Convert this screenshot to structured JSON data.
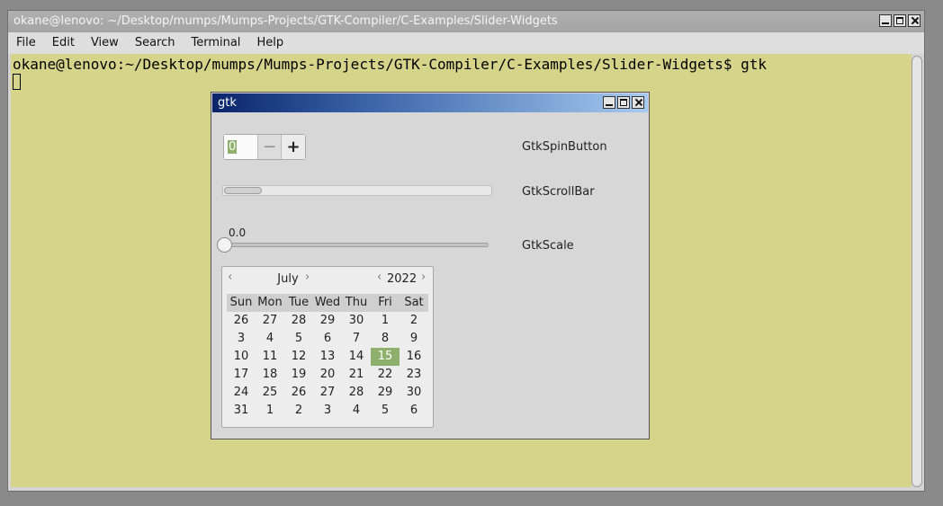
{
  "terminal": {
    "title": "okane@lenovo: ~/Desktop/mumps/Mumps-Projects/GTK-Compiler/C-Examples/Slider-Widgets",
    "menu": [
      "File",
      "Edit",
      "View",
      "Search",
      "Terminal",
      "Help"
    ],
    "prompt": "okane@lenovo:~/Desktop/mumps/Mumps-Projects/GTK-Compiler/C-Examples/Slider-Widgets$ gtk",
    "background_color": "#d6d38a"
  },
  "dialog": {
    "title": "gtk",
    "spin": {
      "value": "0",
      "minus": "−",
      "plus": "+",
      "label": "GtkSpinButton"
    },
    "scrollbar": {
      "label": "GtkScrollBar"
    },
    "scale": {
      "value_text": "0.0",
      "label": "GtkScale",
      "value": 0.0
    },
    "calendar": {
      "month": "July",
      "year": "2022",
      "prev_month": "‹",
      "next_month": "›",
      "prev_year": "‹",
      "next_year": "›",
      "weekdays": [
        "Sun",
        "Mon",
        "Tue",
        "Wed",
        "Thu",
        "Fri",
        "Sat"
      ],
      "weeks": [
        [
          "26",
          "27",
          "28",
          "29",
          "30",
          "1",
          "2"
        ],
        [
          "3",
          "4",
          "5",
          "6",
          "7",
          "8",
          "9"
        ],
        [
          "10",
          "11",
          "12",
          "13",
          "14",
          "15",
          "16"
        ],
        [
          "17",
          "18",
          "19",
          "20",
          "21",
          "22",
          "23"
        ],
        [
          "24",
          "25",
          "26",
          "27",
          "28",
          "29",
          "30"
        ],
        [
          "31",
          "1",
          "2",
          "3",
          "4",
          "5",
          "6"
        ]
      ],
      "selected_day": "15",
      "selected_color": "#8fb06c"
    }
  }
}
